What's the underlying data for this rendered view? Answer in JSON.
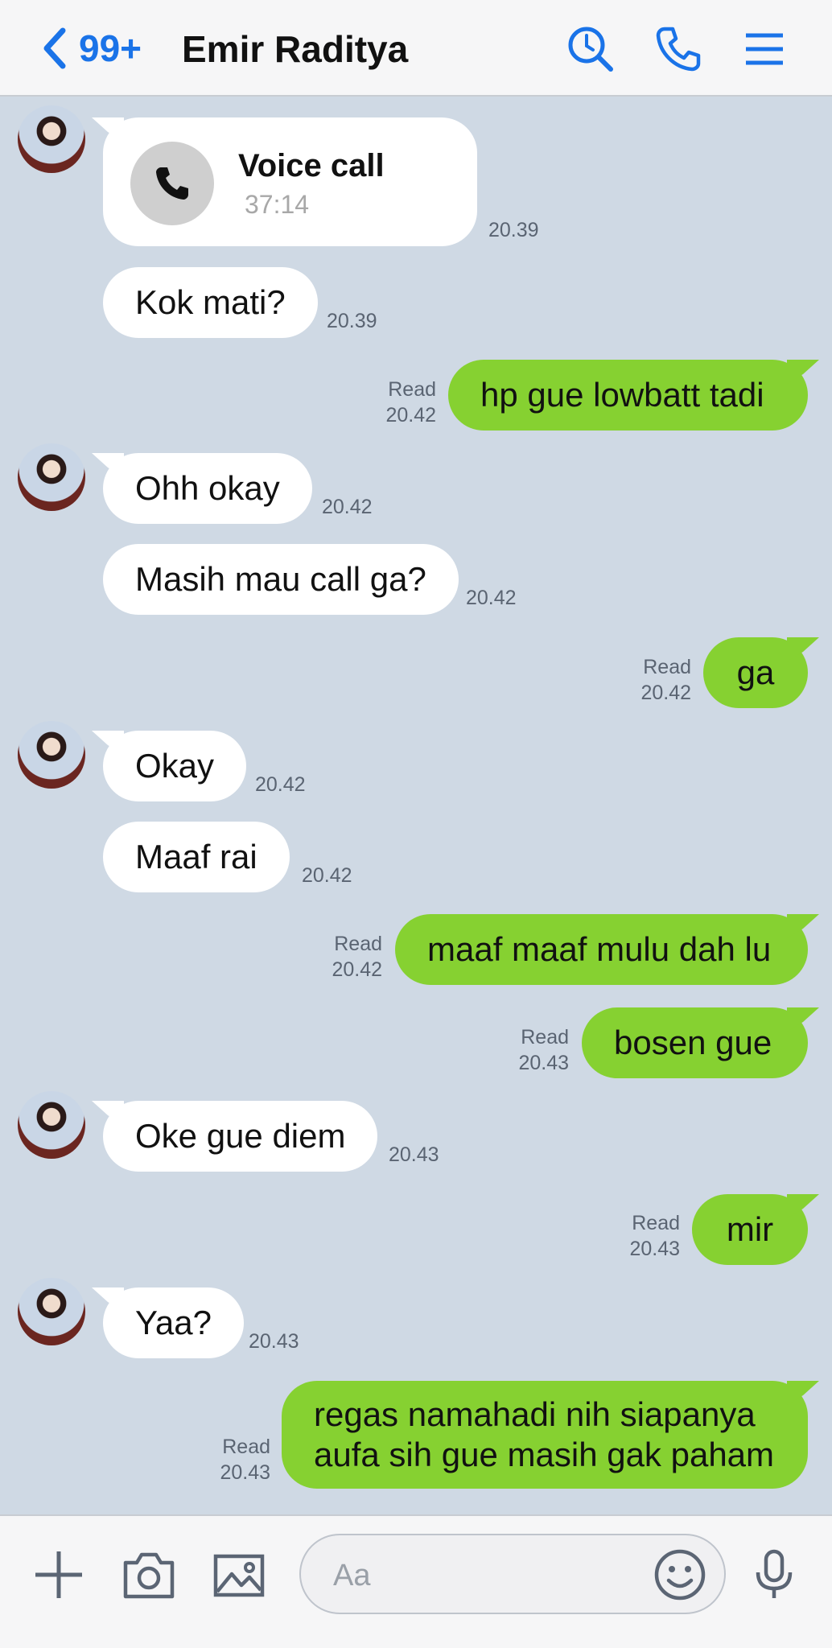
{
  "header": {
    "back_count": "99+",
    "contact_name": "Emir Raditya",
    "icons": [
      "search-icon",
      "phone-icon",
      "menu-icon"
    ],
    "accent_color": "#1a73e8"
  },
  "call_card": {
    "title": "Voice call",
    "duration": "37:14",
    "time": "20.39"
  },
  "messages": [
    {
      "text": "Kok mati?",
      "time": "20.39"
    },
    {
      "text": "hp gue lowbatt tadi",
      "status": "Read",
      "time": "20.42"
    },
    {
      "text": "Ohh okay",
      "time": "20.42"
    },
    {
      "text": "Masih mau call ga?",
      "time": "20.42"
    },
    {
      "text": "ga",
      "status": "Read",
      "time": "20.42"
    },
    {
      "text": "Okay",
      "time": "20.42"
    },
    {
      "text": "Maaf rai",
      "time": "20.42"
    },
    {
      "text": "maaf maaf mulu dah lu",
      "status": "Read",
      "time": "20.42"
    },
    {
      "text": "bosen gue",
      "status": "Read",
      "time": "20.43"
    },
    {
      "text": "Oke gue diem",
      "time": "20.43"
    },
    {
      "text": "mir",
      "status": "Read",
      "time": "20.43"
    },
    {
      "text": "Yaa?",
      "time": "20.43"
    },
    {
      "text": "regas namahadi nih siapanya aufa sih gue masih gak paham",
      "status": "Read",
      "time": "20.43"
    }
  ],
  "input": {
    "placeholder": "Aa"
  },
  "colors": {
    "chat_bg": "#cfd9e4",
    "outgoing_bubble": "#86d131",
    "incoming_bubble": "#ffffff"
  }
}
